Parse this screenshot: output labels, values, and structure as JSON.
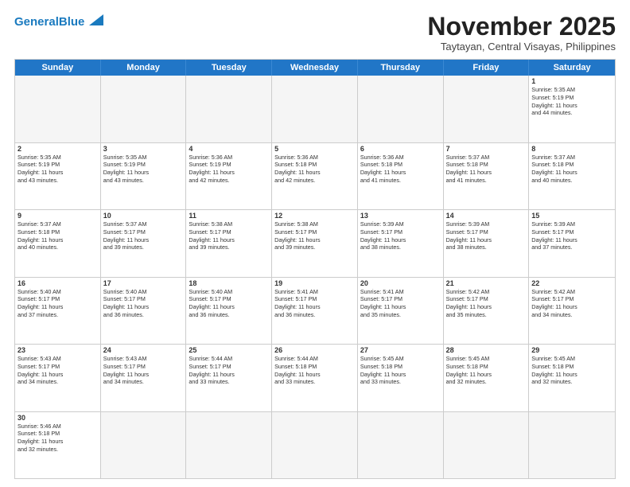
{
  "header": {
    "logo_general": "General",
    "logo_blue": "Blue",
    "month_title": "November 2025",
    "subtitle": "Taytayan, Central Visayas, Philippines"
  },
  "days_of_week": [
    "Sunday",
    "Monday",
    "Tuesday",
    "Wednesday",
    "Thursday",
    "Friday",
    "Saturday"
  ],
  "weeks": [
    [
      {
        "day": "",
        "content": ""
      },
      {
        "day": "",
        "content": ""
      },
      {
        "day": "",
        "content": ""
      },
      {
        "day": "",
        "content": ""
      },
      {
        "day": "",
        "content": ""
      },
      {
        "day": "",
        "content": ""
      },
      {
        "day": "1",
        "content": "Sunrise: 5:35 AM\nSunset: 5:19 PM\nDaylight: 11 hours\nand 44 minutes."
      }
    ],
    [
      {
        "day": "2",
        "content": "Sunrise: 5:35 AM\nSunset: 5:19 PM\nDaylight: 11 hours\nand 43 minutes."
      },
      {
        "day": "3",
        "content": "Sunrise: 5:35 AM\nSunset: 5:19 PM\nDaylight: 11 hours\nand 43 minutes."
      },
      {
        "day": "4",
        "content": "Sunrise: 5:36 AM\nSunset: 5:19 PM\nDaylight: 11 hours\nand 42 minutes."
      },
      {
        "day": "5",
        "content": "Sunrise: 5:36 AM\nSunset: 5:18 PM\nDaylight: 11 hours\nand 42 minutes."
      },
      {
        "day": "6",
        "content": "Sunrise: 5:36 AM\nSunset: 5:18 PM\nDaylight: 11 hours\nand 41 minutes."
      },
      {
        "day": "7",
        "content": "Sunrise: 5:37 AM\nSunset: 5:18 PM\nDaylight: 11 hours\nand 41 minutes."
      },
      {
        "day": "8",
        "content": "Sunrise: 5:37 AM\nSunset: 5:18 PM\nDaylight: 11 hours\nand 40 minutes."
      }
    ],
    [
      {
        "day": "9",
        "content": "Sunrise: 5:37 AM\nSunset: 5:18 PM\nDaylight: 11 hours\nand 40 minutes."
      },
      {
        "day": "10",
        "content": "Sunrise: 5:37 AM\nSunset: 5:17 PM\nDaylight: 11 hours\nand 39 minutes."
      },
      {
        "day": "11",
        "content": "Sunrise: 5:38 AM\nSunset: 5:17 PM\nDaylight: 11 hours\nand 39 minutes."
      },
      {
        "day": "12",
        "content": "Sunrise: 5:38 AM\nSunset: 5:17 PM\nDaylight: 11 hours\nand 39 minutes."
      },
      {
        "day": "13",
        "content": "Sunrise: 5:39 AM\nSunset: 5:17 PM\nDaylight: 11 hours\nand 38 minutes."
      },
      {
        "day": "14",
        "content": "Sunrise: 5:39 AM\nSunset: 5:17 PM\nDaylight: 11 hours\nand 38 minutes."
      },
      {
        "day": "15",
        "content": "Sunrise: 5:39 AM\nSunset: 5:17 PM\nDaylight: 11 hours\nand 37 minutes."
      }
    ],
    [
      {
        "day": "16",
        "content": "Sunrise: 5:40 AM\nSunset: 5:17 PM\nDaylight: 11 hours\nand 37 minutes."
      },
      {
        "day": "17",
        "content": "Sunrise: 5:40 AM\nSunset: 5:17 PM\nDaylight: 11 hours\nand 36 minutes."
      },
      {
        "day": "18",
        "content": "Sunrise: 5:40 AM\nSunset: 5:17 PM\nDaylight: 11 hours\nand 36 minutes."
      },
      {
        "day": "19",
        "content": "Sunrise: 5:41 AM\nSunset: 5:17 PM\nDaylight: 11 hours\nand 36 minutes."
      },
      {
        "day": "20",
        "content": "Sunrise: 5:41 AM\nSunset: 5:17 PM\nDaylight: 11 hours\nand 35 minutes."
      },
      {
        "day": "21",
        "content": "Sunrise: 5:42 AM\nSunset: 5:17 PM\nDaylight: 11 hours\nand 35 minutes."
      },
      {
        "day": "22",
        "content": "Sunrise: 5:42 AM\nSunset: 5:17 PM\nDaylight: 11 hours\nand 34 minutes."
      }
    ],
    [
      {
        "day": "23",
        "content": "Sunrise: 5:43 AM\nSunset: 5:17 PM\nDaylight: 11 hours\nand 34 minutes."
      },
      {
        "day": "24",
        "content": "Sunrise: 5:43 AM\nSunset: 5:17 PM\nDaylight: 11 hours\nand 34 minutes."
      },
      {
        "day": "25",
        "content": "Sunrise: 5:44 AM\nSunset: 5:17 PM\nDaylight: 11 hours\nand 33 minutes."
      },
      {
        "day": "26",
        "content": "Sunrise: 5:44 AM\nSunset: 5:18 PM\nDaylight: 11 hours\nand 33 minutes."
      },
      {
        "day": "27",
        "content": "Sunrise: 5:45 AM\nSunset: 5:18 PM\nDaylight: 11 hours\nand 33 minutes."
      },
      {
        "day": "28",
        "content": "Sunrise: 5:45 AM\nSunset: 5:18 PM\nDaylight: 11 hours\nand 32 minutes."
      },
      {
        "day": "29",
        "content": "Sunrise: 5:45 AM\nSunset: 5:18 PM\nDaylight: 11 hours\nand 32 minutes."
      }
    ],
    [
      {
        "day": "30",
        "content": "Sunrise: 5:46 AM\nSunset: 5:18 PM\nDaylight: 11 hours\nand 32 minutes."
      },
      {
        "day": "",
        "content": ""
      },
      {
        "day": "",
        "content": ""
      },
      {
        "day": "",
        "content": ""
      },
      {
        "day": "",
        "content": ""
      },
      {
        "day": "",
        "content": ""
      },
      {
        "day": "",
        "content": ""
      }
    ]
  ]
}
